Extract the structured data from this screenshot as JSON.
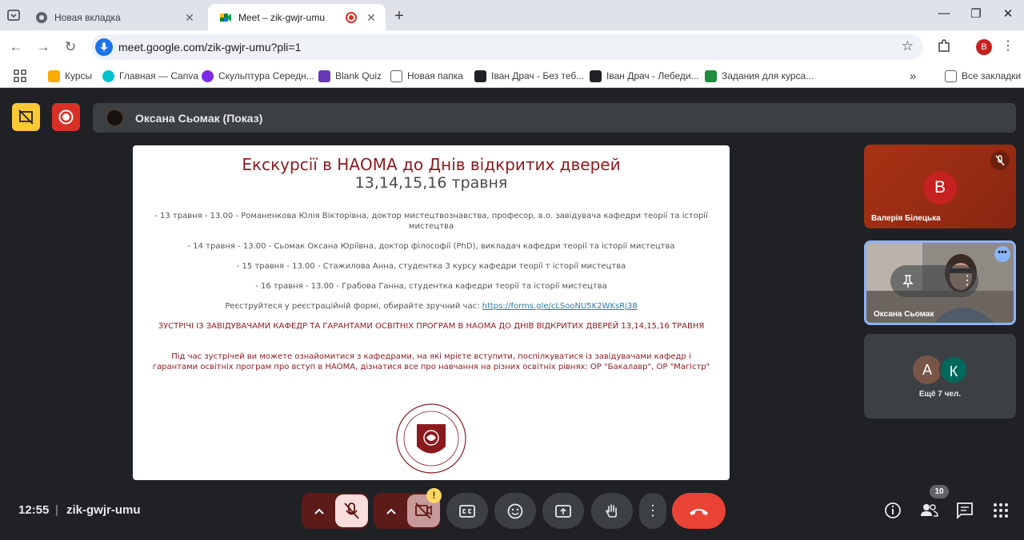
{
  "browser": {
    "tabs": [
      {
        "title": "Новая вкладка",
        "icon": "chrome-icon",
        "active": false
      },
      {
        "title": "Meet – zik-gwjr-umu",
        "icon": "meet-icon",
        "active": true
      }
    ],
    "url": "meet.google.com/zik-gwjr-umu?pli=1",
    "profile_initial": "B"
  },
  "bookmarks": [
    {
      "label": "Курсы",
      "icon": "classroom-icon",
      "color": "#f9ab00"
    },
    {
      "label": "Главная — Canva",
      "icon": "canva-icon",
      "color": "#00c4cc"
    },
    {
      "label": "Скульптура Середн...",
      "icon": "canva-icon",
      "color": "#7d2ae8"
    },
    {
      "label": "Blank Quiz",
      "icon": "forms-icon",
      "color": "#673ab7"
    },
    {
      "label": "Новая папка",
      "icon": "folder-icon",
      "color": "#5f6368"
    },
    {
      "label": "Іван Драч - Без теб...",
      "icon": "lambda-icon",
      "color": "#202124"
    },
    {
      "label": "Іван Драч - Лебеди...",
      "icon": "lambda-icon",
      "color": "#202124"
    },
    {
      "label": "Задания для курса...",
      "icon": "classroom-icon",
      "color": "#1e8e3e"
    }
  ],
  "all_bookmarks_label": "Все закладки",
  "meet": {
    "presenter_name": "Оксана Сьомак (Показ)",
    "slide": {
      "title": "Екскурсії в НАОМА до Днів відкритих дверей",
      "dates": "13,14,15,16 травня",
      "lines": [
        "- 13 травня - 13.00 - Романенкова Юлія Вікторівна, доктор мистецтвознавства, професор, в.о. завідувача кафедри теорії та історії мистецтва",
        "- 14 травня - 13.00 - Сьомак Оксана Юріївна, доктор філософії (PhD), викладач кафедри теорії та історії мистецтва",
        "- 15 травня - 13.00 - Стажилова Анна,  студентка 3 курсу кафедри теорії т історії мистецтва",
        "- 16 травня - 13.00 - Грабова Ганна, студентка кафедри теорії та історії мистецтва"
      ],
      "register_text": "Реєструйтеся у реєстраційній формі, обирайте зручний час: ",
      "register_link": "https://forms.gle/cLSooNU5K2WKsRj38",
      "headline": "ЗУСТРІЧІ ІЗ ЗАВІДУВАЧАМИ КАФЕДР ТА ГАРАНТАМИ ОСВІТНІХ ПРОГРАМ В НАОМА ДО ДНІВ ВІДКРИТИХ ДВЕРЕЙ 13,14,15,16 ТРАВНЯ",
      "body": "Під час зустрічей ви можете ознайомитися з кафедрами, на які мрієте вступити, поспілкуватися із завідувачами кафедр і гарантами освітніх програм про вступ в НАОМА, дізнатися все про навчання на різних освітніх рівнях: ОР \"Бакалавр\", ОР \"Магістр\""
    },
    "participants": [
      {
        "name": "Валерія Білецька",
        "initial": "В",
        "muted": true
      },
      {
        "name": "Оксана Сьомак",
        "initial": "",
        "video": true
      }
    ],
    "others": {
      "initials": [
        "А",
        "К"
      ],
      "label": "Ещё 7 чел."
    },
    "time": "12:55",
    "meeting_code": "zik-gwjr-umu",
    "participants_count": "10",
    "warning_badge": "!"
  }
}
